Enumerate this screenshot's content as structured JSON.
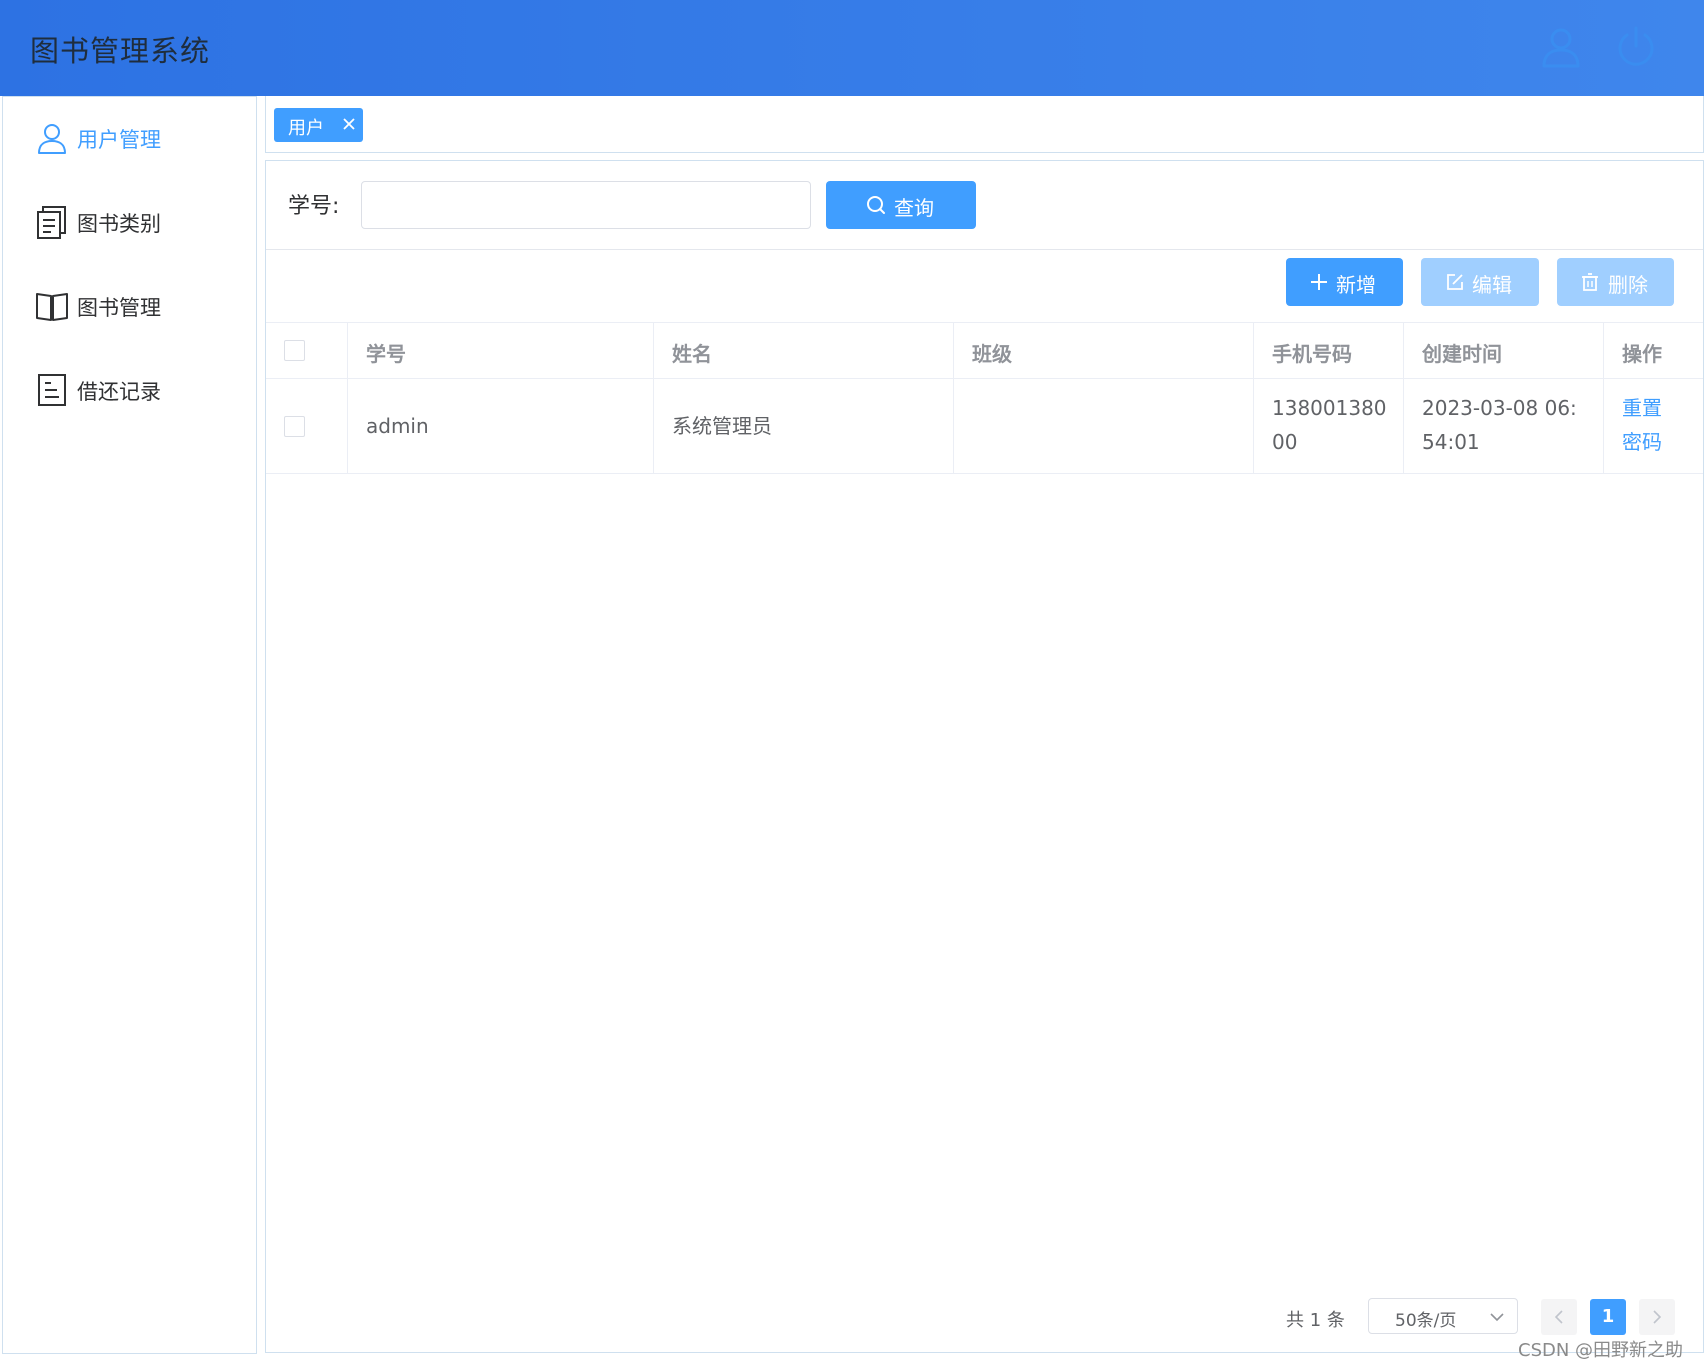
{
  "header": {
    "title": "图书管理系统",
    "icons": {
      "user": "user-icon",
      "power": "power-icon"
    }
  },
  "sidebar": {
    "items": [
      {
        "label": "用户管理",
        "icon": "user-icon",
        "active": true
      },
      {
        "label": "图书类别",
        "icon": "category-icon",
        "active": false
      },
      {
        "label": "图书管理",
        "icon": "book-icon",
        "active": false
      },
      {
        "label": "借还记录",
        "icon": "record-icon",
        "active": false
      }
    ]
  },
  "tabs": [
    {
      "label": "用户",
      "closable": true
    }
  ],
  "search": {
    "label": "学号:",
    "value": "",
    "placeholder": "",
    "button_label": "查询"
  },
  "toolbar": {
    "add_label": "新增",
    "edit_label": "编辑",
    "delete_label": "删除"
  },
  "table": {
    "columns": [
      "学号",
      "姓名",
      "班级",
      "手机号码",
      "创建时间",
      "操作"
    ],
    "rows": [
      {
        "id": "admin",
        "name": "系统管理员",
        "class": "",
        "phone_line1": "138001380",
        "phone_line2": "00",
        "created_line1": "2023-03-08 06:",
        "created_line2": "54:01",
        "action_line1": "重置",
        "action_line2": "密码"
      }
    ]
  },
  "pagination": {
    "total_text": "共 1 条",
    "page_size": "50条/页",
    "current_page": "1"
  },
  "watermark": "CSDN @田野新之助",
  "colors": {
    "primary": "#409eff",
    "primary_light": "#a0cfff",
    "header_start": "#2d72e3",
    "header_end": "#3f86ec"
  }
}
